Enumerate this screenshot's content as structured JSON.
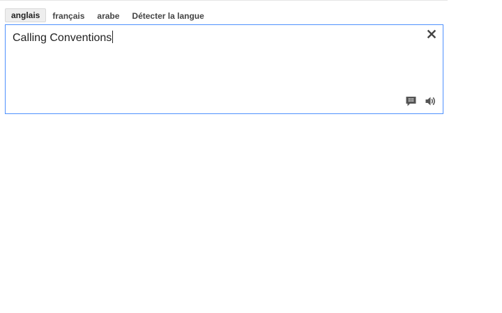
{
  "language_tabs": [
    {
      "label": "anglais",
      "active": true
    },
    {
      "label": "français",
      "active": false
    },
    {
      "label": "arabe",
      "active": false
    },
    {
      "label": "Détecter la langue",
      "active": false
    }
  ],
  "source": {
    "text": "Calling Conventions"
  },
  "icons": {
    "clear": "close-icon",
    "input_tools": "speech-bubble-icon",
    "listen": "speaker-icon"
  },
  "colors": {
    "focus_border": "#4d90fe",
    "active_tab_bg": "#eeeeee"
  }
}
